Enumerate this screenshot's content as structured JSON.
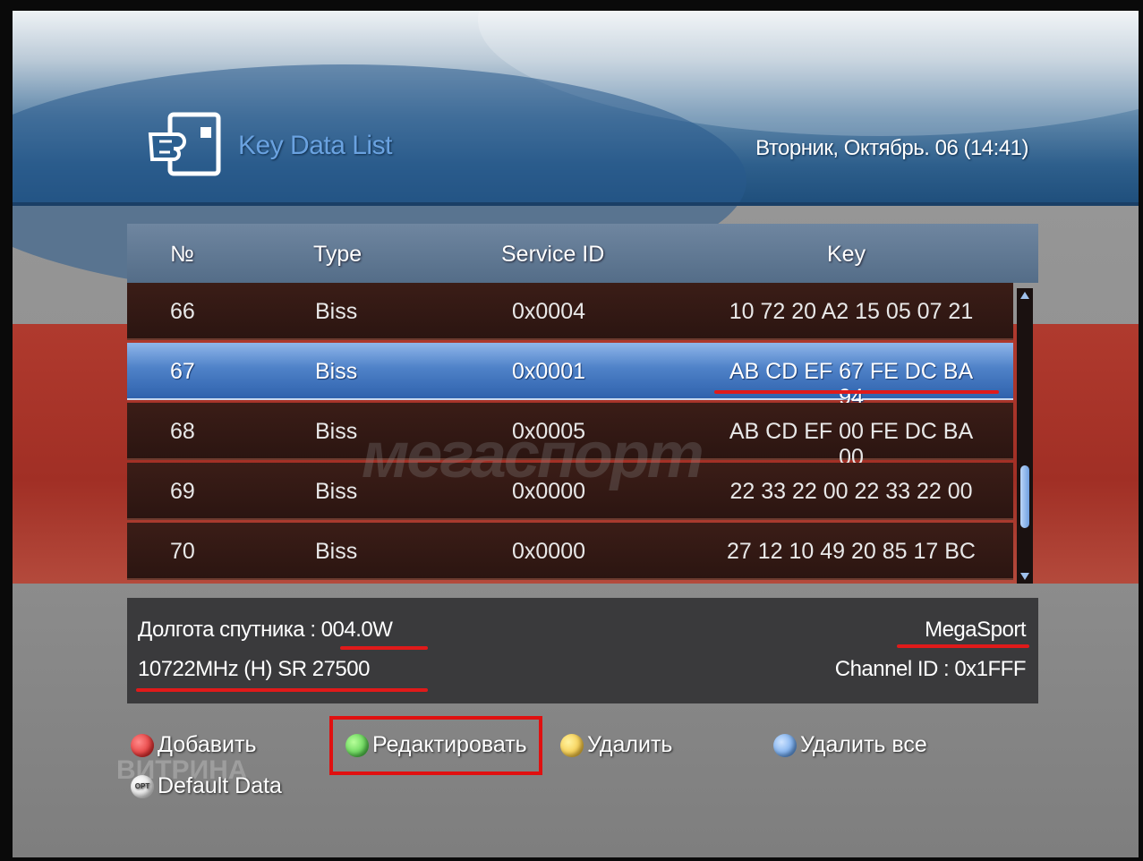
{
  "header": {
    "title": "Key Data List",
    "datetime": "Вторник, Октябрь. 06 (14:41)"
  },
  "table": {
    "columns": [
      "№",
      "Type",
      "Service ID",
      "Key"
    ],
    "rows": [
      {
        "num": "66",
        "type": "Biss",
        "service_id": "0x0004",
        "key": "10 72 20 A2 15 05 07 21"
      },
      {
        "num": "67",
        "type": "Biss",
        "service_id": "0x0001",
        "key": "AB CD EF 67 FE DC BA 94"
      },
      {
        "num": "68",
        "type": "Biss",
        "service_id": "0x0005",
        "key": "AB CD EF 00 FE DC BA 00"
      },
      {
        "num": "69",
        "type": "Biss",
        "service_id": "0x0000",
        "key": "22 33 22 00 22 33 22 00"
      },
      {
        "num": "70",
        "type": "Biss",
        "service_id": "0x0000",
        "key": "27 12 10 49 20 85 17 BC"
      }
    ],
    "selected_row": "67"
  },
  "watermark": "мегаспорт",
  "info": {
    "satellite_position": "Долгота спутника : 004.0W",
    "frequency": "10722MHz  (H)  SR 27500",
    "channel_name": "MegaSport",
    "channel_id": "Channel ID : 0x1FFF"
  },
  "buttons": {
    "add": "Добавить",
    "edit": "Редактировать",
    "delete": "Удалить",
    "delete_all": "Удалить все",
    "default_data": "Default Data",
    "opt_badge": "OPT"
  },
  "faint_overlay": "ВИТРИНА",
  "colors": {
    "accent_blue": "#4f82c8",
    "header_blue": "#2e5f8c",
    "annotation_red": "#e01a1a",
    "band_red": "#a12f25"
  }
}
